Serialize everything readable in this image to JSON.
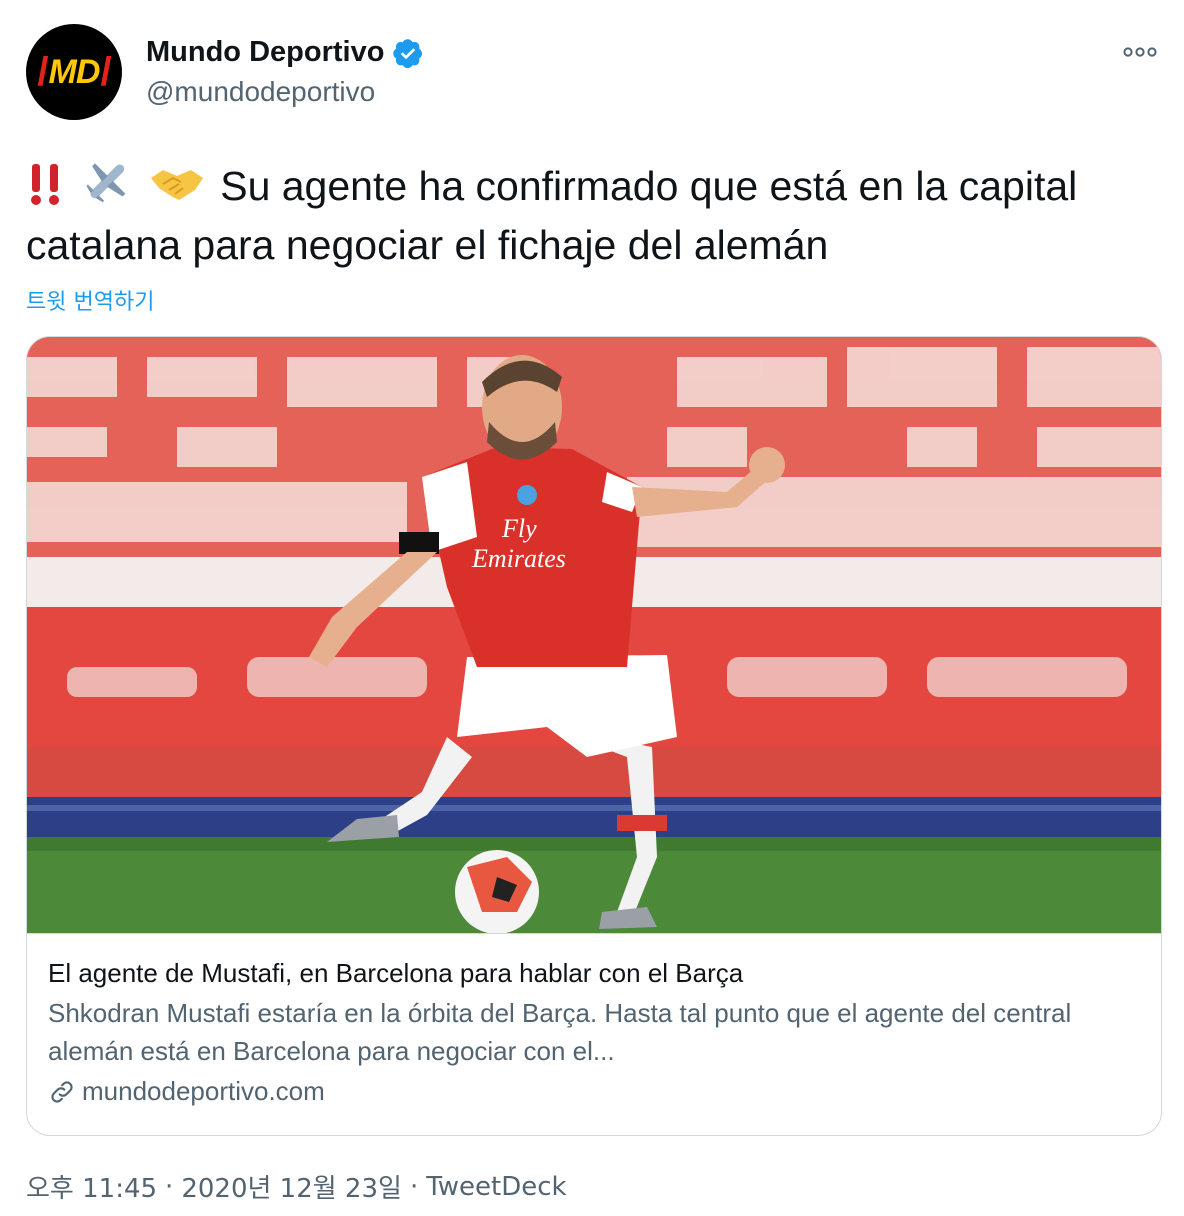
{
  "account": {
    "display_name": "Mundo Deportivo",
    "handle": "@mundodeportivo",
    "avatar_text": "MD",
    "verified": true,
    "verified_color": "#1d9bf0"
  },
  "tweet": {
    "emojis": [
      "double-exclamation",
      "airplane",
      "handshake"
    ],
    "text": "Su agente ha confirmado que está en la capital catalana para negociar el fichaje del alemán",
    "translate_label": "트윗 번역하기"
  },
  "card": {
    "image_alt": "Arsenal player in red and white kit striking a football in an empty stadium",
    "title": "El agente de Mustafi, en Barcelona para hablar con el Barça",
    "description": "Shkodran Mustafi estaría en la órbita del Barça. Hasta tal punto que el agente del central alemán está en Barcelona para negociar con el...",
    "domain": "mundodeportivo.com"
  },
  "footer": {
    "time": "오후 11:45",
    "separator1": "·",
    "date": "2020년 12월 23일",
    "separator2": "·",
    "source": "TweetDeck"
  },
  "colors": {
    "link_blue": "#1d9bf0",
    "secondary_text": "#536471",
    "border": "#cfd9de",
    "stadium_red": "#e0453d",
    "pitch_green": "#4c8a3a"
  }
}
